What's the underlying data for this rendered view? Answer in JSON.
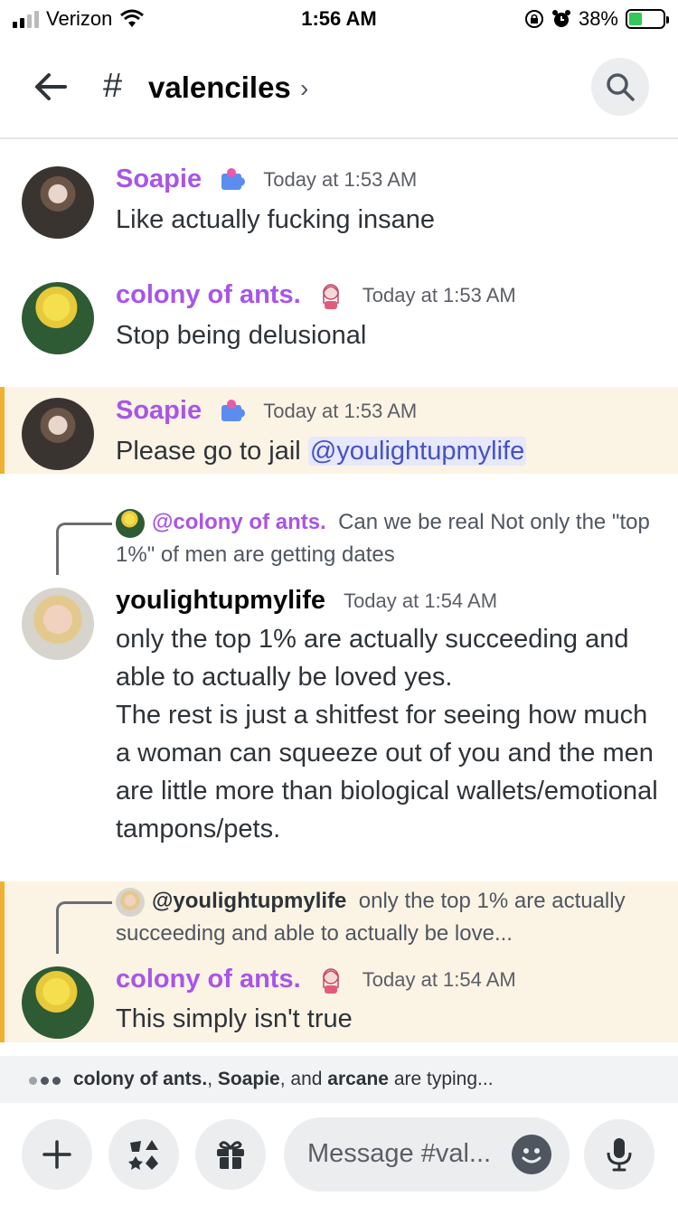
{
  "status": {
    "carrier": "Verizon",
    "time": "1:56 AM",
    "battery": "38%",
    "battery_level": 0.38
  },
  "header": {
    "channel_name": "valenciles"
  },
  "messages": [
    {
      "author": "Soapie",
      "timestamp": "Today at 1:53 AM",
      "text": "Like actually fucking insane"
    },
    {
      "author": "colony of ants.",
      "timestamp": "Today at 1:53 AM",
      "text": "Stop being delusional"
    },
    {
      "author": "Soapie",
      "timestamp": "Today at 1:53 AM",
      "text": "Please go to jail ",
      "mention": "@youlightupmylife"
    },
    {
      "reply_author": "@colony of ants.",
      "reply_text": "Can we be real  Not only the \"top 1%\" of men are getting dates",
      "author": "youlightupmylife",
      "timestamp": "Today at 1:54 AM",
      "text": "only the top 1% are actually succeeding and able to actually be loved yes.\nThe rest is just a shitfest for seeing how much a woman can squeeze out of you and the men are little more than biological wallets/emotional tampons/pets."
    },
    {
      "reply_author": "@youlightupmylife",
      "reply_text": "only the top 1% are actually succeeding and able to actually be love...",
      "author": "colony of ants.",
      "timestamp": "Today at 1:54 AM",
      "text": "This simply isn't true"
    }
  ],
  "typing": {
    "user1": "colony of ants.",
    "sep1": ", ",
    "user2": "Soapie",
    "sep2": ", and ",
    "user3": "arcane",
    "suffix": " are typing..."
  },
  "composer": {
    "placeholder": "Message #val..."
  },
  "colors": {
    "accent_purple": "#a855e8",
    "highlight_bg": "#fbf3e4",
    "highlight_bar": "#f0b132",
    "mention_text": "#4752c4"
  },
  "icons": [
    "signal-icon",
    "wifi-icon",
    "orientation-lock-icon",
    "alarm-icon",
    "battery-icon",
    "back-arrow-icon",
    "hash-icon",
    "chevron-right-icon",
    "search-icon",
    "puzzle-badge-icon",
    "girl-badge-icon",
    "plus-icon",
    "apps-icon",
    "gift-icon",
    "emoji-icon",
    "microphone-icon"
  ]
}
